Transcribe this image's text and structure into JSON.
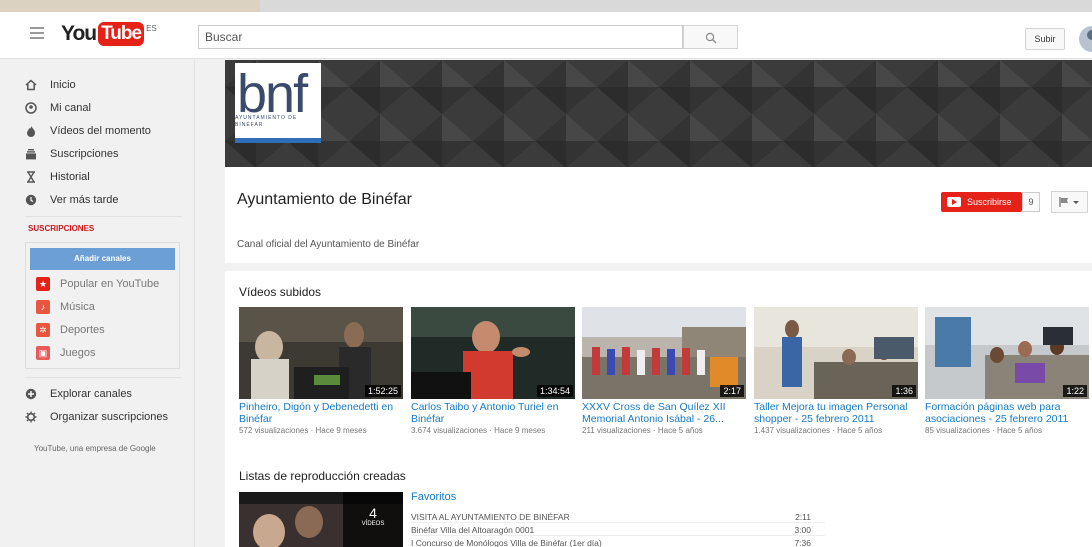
{
  "masthead": {
    "logo_you": "You",
    "logo_tube": "Tube",
    "region": "ES",
    "search_placeholder": "Buscar",
    "upload_label": "Subir"
  },
  "guide": {
    "items": [
      {
        "label": "Inicio",
        "icon": "home-icon"
      },
      {
        "label": "Mi canal",
        "icon": "person-icon"
      },
      {
        "label": "Vídeos del momento",
        "icon": "flame-icon"
      },
      {
        "label": "Suscripciones",
        "icon": "subscriptions-icon"
      },
      {
        "label": "Historial",
        "icon": "hourglass-icon"
      },
      {
        "label": "Ver más tarde",
        "icon": "clock-icon"
      }
    ],
    "subscriptions_title": "SUSCRIPCIONES",
    "add_channels": "Añadir canales",
    "channels": [
      {
        "label": "Popular en YouTube",
        "icon": "star-icon",
        "color": "#e62117"
      },
      {
        "label": "Música",
        "icon": "music-icon",
        "color": "#e8563f"
      },
      {
        "label": "Deportes",
        "icon": "sports-icon",
        "color": "#e8563f"
      },
      {
        "label": "Juegos",
        "icon": "gamepad-icon",
        "color": "#e85a5a"
      }
    ],
    "bottom": [
      {
        "label": "Explorar canales",
        "icon": "plus-circle-icon"
      },
      {
        "label": "Organizar suscripciones",
        "icon": "gear-icon"
      }
    ],
    "footer": "YouTube, una empresa de Google"
  },
  "channel": {
    "logo_text": "bnf",
    "logo_sub": "AYUNTAMIENTO DE BINÉFAR",
    "title": "Ayuntamiento de Binéfar",
    "subscribe_label": "Suscribirse",
    "subscriber_count": "9",
    "description": "Canal oficial del Ayuntamiento de Binéfar"
  },
  "uploads": {
    "title": "Vídeos subidos",
    "videos": [
      {
        "title": "Pinheiro, Digón y Debenedetti en Binéfar",
        "views": "572 visualizaciones",
        "age": "Hace 9 meses",
        "duration": "1:52:25"
      },
      {
        "title": "Carlos Taibo y Antonio Turiel en Binéfar",
        "views": "3.674 visualizaciones",
        "age": "Hace 9 meses",
        "duration": "1:34:54"
      },
      {
        "title": "XXXV Cross de San Quílez XII Memorial Antonio Isábal - 26...",
        "views": "211 visualizaciones",
        "age": "Hace 5 años",
        "duration": "2:17"
      },
      {
        "title": "Taller Mejora tu imagen Personal shopper - 25 febrero 2011",
        "views": "1.437 visualizaciones",
        "age": "Hace 5 años",
        "duration": "1:36"
      },
      {
        "title": "Formación páginas web para asociaciones - 25 febrero 2011",
        "views": "85 visualizaciones",
        "age": "Hace 5 años",
        "duration": "1:22"
      }
    ]
  },
  "playlists": {
    "title": "Listas de reproducción creadas",
    "playlist": {
      "name": "Favoritos",
      "count": "4",
      "count_label": "VÍDEOS",
      "items": [
        {
          "title": "VISITA AL AYUNTAMIENTO DE BINÉFAR",
          "duration": "2:11"
        },
        {
          "title": "Binéfar Villa del Altoaragón 0001",
          "duration": "3:00"
        },
        {
          "title": "I Concurso de Monólogos Villa de Binéfar (1er día)",
          "duration": "7:36"
        }
      ]
    }
  },
  "colors": {
    "accent_red": "#e62117",
    "link_blue": "#167ac6",
    "add_channels_blue": "#6b9fd6"
  }
}
